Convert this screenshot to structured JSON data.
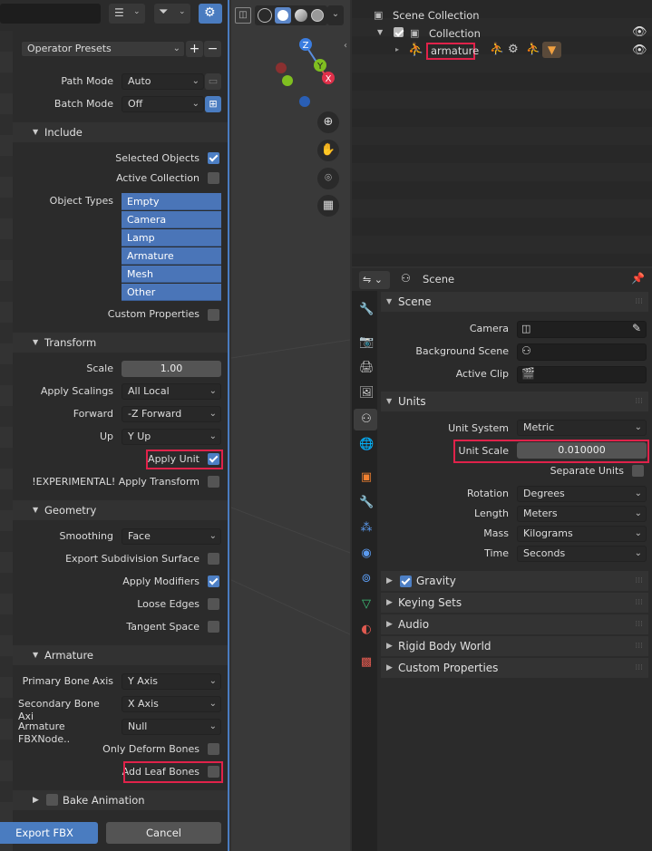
{
  "export_panel": {
    "operator_presets": "Operator Presets",
    "path_mode": {
      "label": "Path Mode",
      "value": "Auto"
    },
    "batch_mode": {
      "label": "Batch Mode",
      "value": "Off"
    },
    "include": {
      "title": "Include",
      "selected_objects": {
        "label": "Selected Objects",
        "checked": true
      },
      "active_collection": {
        "label": "Active Collection",
        "checked": false
      },
      "object_types_label": "Object Types",
      "object_types": [
        "Empty",
        "Camera",
        "Lamp",
        "Armature",
        "Mesh",
        "Other"
      ],
      "custom_properties": {
        "label": "Custom Properties",
        "checked": false
      }
    },
    "transform": {
      "title": "Transform",
      "scale": {
        "label": "Scale",
        "value": "1.00"
      },
      "apply_scalings": {
        "label": "Apply Scalings",
        "value": "All Local"
      },
      "forward": {
        "label": "Forward",
        "value": "-Z Forward"
      },
      "up": {
        "label": "Up",
        "value": "Y Up"
      },
      "apply_unit": {
        "label": "Apply Unit",
        "checked": true
      },
      "apply_transform": {
        "label": "!EXPERIMENTAL! Apply Transform",
        "checked": false
      }
    },
    "geometry": {
      "title": "Geometry",
      "smoothing": {
        "label": "Smoothing",
        "value": "Face"
      },
      "export_subdivision": {
        "label": "Export Subdivision Surface",
        "checked": false
      },
      "apply_modifiers": {
        "label": "Apply Modifiers",
        "checked": true
      },
      "loose_edges": {
        "label": "Loose Edges",
        "checked": false
      },
      "tangent_space": {
        "label": "Tangent Space",
        "checked": false
      }
    },
    "armature": {
      "title": "Armature",
      "primary_bone_axis": {
        "label": "Primary Bone Axis",
        "value": "Y Axis"
      },
      "secondary_bone_axis": {
        "label": "Secondary Bone Axi",
        "value": "X Axis"
      },
      "fbx_node": {
        "label": "Armature FBXNode..",
        "value": "Null"
      },
      "only_deform_bones": {
        "label": "Only Deform Bones",
        "checked": false
      },
      "add_leaf_bones": {
        "label": "Add Leaf Bones",
        "checked": false
      }
    },
    "bake_animation": {
      "title": "Bake Animation",
      "checked": false
    },
    "export_button": "Export FBX",
    "cancel_button": "Cancel"
  },
  "viewport": {
    "gizmo": {
      "z": "Z",
      "y": "Y",
      "x": "X"
    }
  },
  "outliner": {
    "scene_collection": "Scene Collection",
    "collection": "Collection",
    "armature": "armature"
  },
  "properties": {
    "header": "Scene",
    "scene_section": {
      "title": "Scene",
      "camera": "Camera",
      "background_scene": "Background Scene",
      "active_clip": "Active Clip"
    },
    "units_section": {
      "title": "Units",
      "unit_system": {
        "label": "Unit System",
        "value": "Metric"
      },
      "unit_scale": {
        "label": "Unit Scale",
        "value": "0.010000"
      },
      "separate_units": {
        "label": "Separate Units",
        "checked": false
      },
      "rotation": {
        "label": "Rotation",
        "value": "Degrees"
      },
      "length": {
        "label": "Length",
        "value": "Meters"
      },
      "mass": {
        "label": "Mass",
        "value": "Kilograms"
      },
      "time": {
        "label": "Time",
        "value": "Seconds"
      }
    },
    "collapsed_sections": [
      "Gravity",
      "Keying Sets",
      "Audio",
      "Rigid Body World",
      "Custom Properties"
    ]
  },
  "colors": {
    "accent": "#4a75b8",
    "highlight": "#e0224a"
  }
}
